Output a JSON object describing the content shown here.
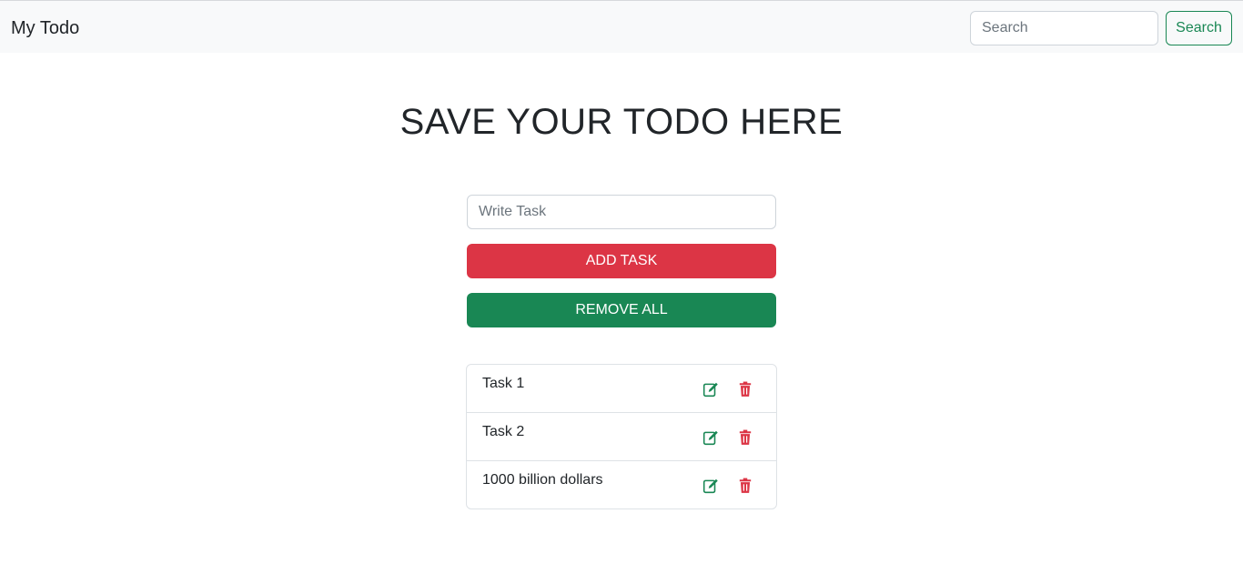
{
  "navbar": {
    "brand": "My Todo",
    "search_placeholder": "Search",
    "search_button": "Search"
  },
  "main": {
    "title": "SAVE YOUR TODO HERE",
    "task_input_placeholder": "Write Task",
    "add_button": "ADD TASK",
    "remove_all_button": "REMOVE ALL"
  },
  "tasks": [
    {
      "text": "Task 1",
      "edit_icon": "edit-icon",
      "delete_icon": "trash-icon"
    },
    {
      "text": "Task 2",
      "edit_icon": "edit-icon",
      "delete_icon": "trash-icon"
    },
    {
      "text": "1000 billion dollars",
      "edit_icon": "edit-icon",
      "delete_icon": "trash-icon"
    }
  ],
  "colors": {
    "navbar_bg": "#f8f9fa",
    "danger": "#dc3545",
    "success": "#198754",
    "text": "#212529",
    "placeholder": "#6c757d"
  }
}
